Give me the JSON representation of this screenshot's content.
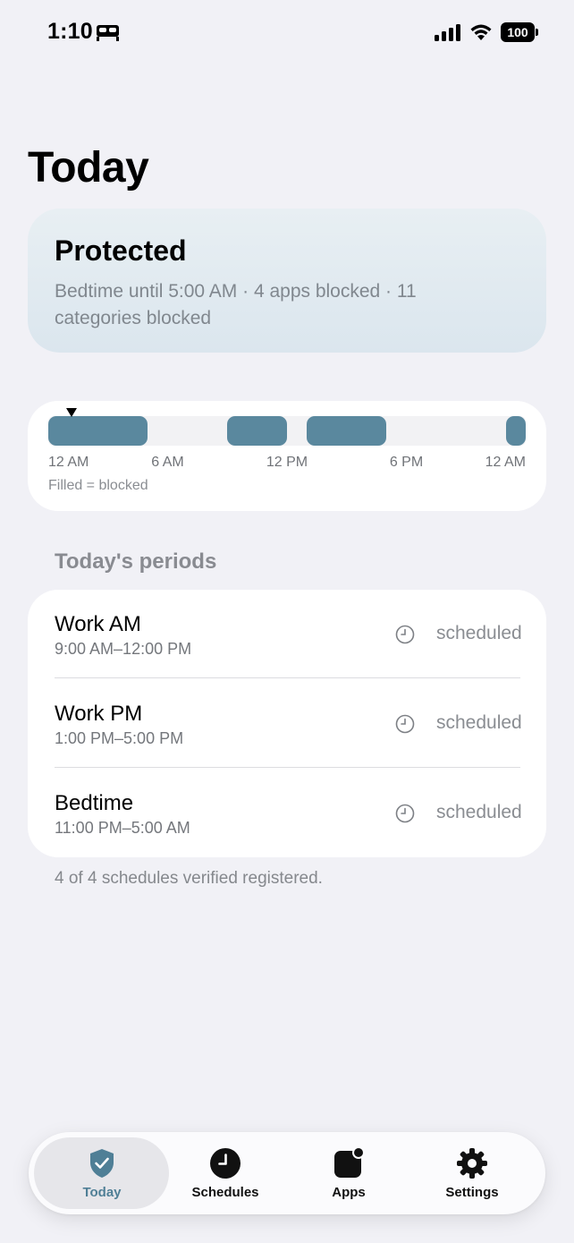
{
  "status_bar": {
    "time": "1:10",
    "battery": "100"
  },
  "page": {
    "title": "Today"
  },
  "status_card": {
    "title": "Protected",
    "description": "Bedtime until 5:00 AM · 4 apps blocked · 11 categories blocked"
  },
  "timeline": {
    "blocked_periods_hours": [
      [
        0,
        5
      ],
      [
        9,
        12
      ],
      [
        13,
        17
      ],
      [
        23,
        24
      ]
    ],
    "current_time_hours": 1.17,
    "ticks": [
      "12 AM",
      "6 AM",
      "12 PM",
      "6 PM",
      "12 AM"
    ],
    "legend": "Filled = blocked",
    "block_color": "#5a889e"
  },
  "periods": {
    "header": "Today's periods",
    "items": [
      {
        "name": "Work AM",
        "time": "9:00 AM–12:00 PM",
        "status": "scheduled"
      },
      {
        "name": "Work PM",
        "time": "1:00 PM–5:00 PM",
        "status": "scheduled"
      },
      {
        "name": "Bedtime",
        "time": "11:00 PM–5:00 AM",
        "status": "scheduled"
      }
    ]
  },
  "footer_note": "4 of 4 schedules verified registered.",
  "tabs": [
    {
      "label": "Today",
      "icon": "shield-check-icon",
      "active": true
    },
    {
      "label": "Schedules",
      "icon": "clock-icon",
      "active": false
    },
    {
      "label": "Apps",
      "icon": "apps-icon",
      "active": false
    },
    {
      "label": "Settings",
      "icon": "gear-icon",
      "active": false
    }
  ],
  "colors": {
    "accent": "#4f7f96",
    "background": "#f1f1f6"
  }
}
